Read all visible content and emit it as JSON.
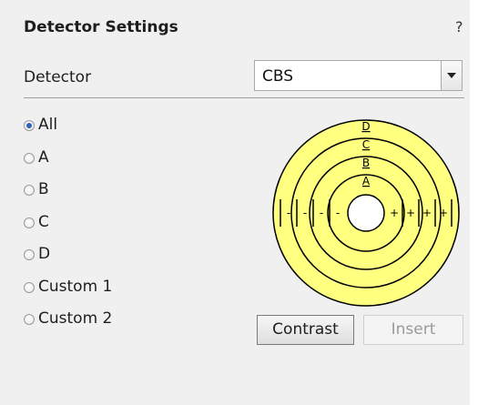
{
  "panel": {
    "title": "Detector Settings",
    "help_label": "?"
  },
  "detector": {
    "label": "Detector",
    "selected": "CBS"
  },
  "segments": {
    "options": [
      "All",
      "A",
      "B",
      "C",
      "D",
      "Custom 1",
      "Custom 2"
    ],
    "selected": "All"
  },
  "diagram": {
    "ring_labels": [
      "A",
      "B",
      "C",
      "D"
    ],
    "minus": "-",
    "plus": "+",
    "fill_color": "#ffff80",
    "stroke_color": "#000000"
  },
  "buttons": {
    "contrast_label": "Contrast",
    "insert_label": "Insert",
    "insert_enabled": false
  }
}
